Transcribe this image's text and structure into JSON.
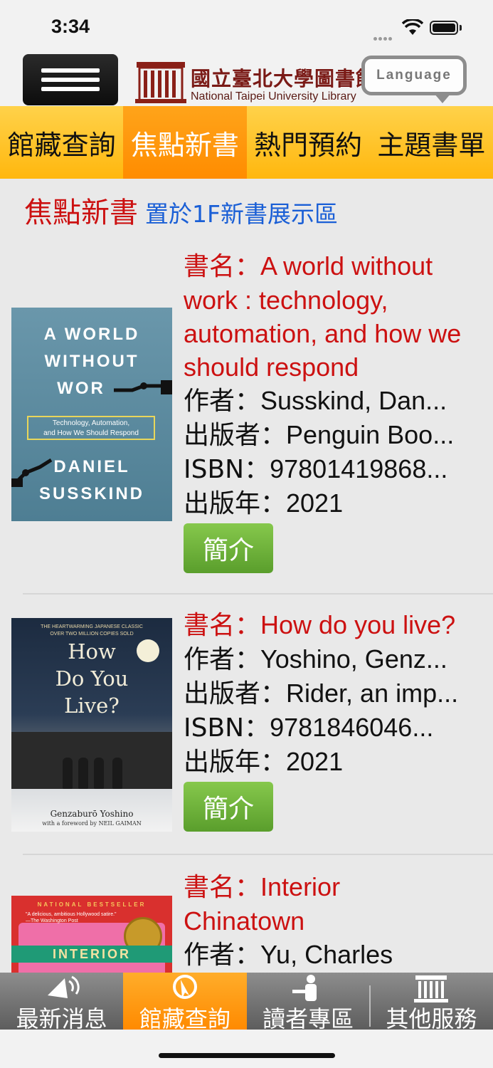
{
  "status_bar": {
    "time": "3:34"
  },
  "header": {
    "logo_title": "國立臺北大學圖書館",
    "logo_subtitle": "National Taipei University Library",
    "language_label": "Language"
  },
  "tabs": [
    {
      "label": "館藏查詢",
      "active": false
    },
    {
      "label": "焦點新書",
      "active": true
    },
    {
      "label": "熱門預約",
      "active": false
    },
    {
      "label": "主題書單",
      "active": false
    }
  ],
  "section": {
    "title": "焦點新書",
    "subtitle": "置於1F新書展示區"
  },
  "labels": {
    "title": "書名：",
    "author": "作者：",
    "publisher": "出版者：",
    "isbn": "ISBN：",
    "year": "出版年：",
    "intro_button": "簡介"
  },
  "books": [
    {
      "title": "A world without work : technology, automation, and how we should respond",
      "author": "Susskind, Dan...",
      "publisher": "Penguin Boo...",
      "isbn": "97801419868...",
      "year": "2021",
      "cover": {
        "line1": "A WORLD",
        "line2": "WITHOUT",
        "line3": "WOR",
        "box_line1": "Technology, Automation,",
        "box_line2": "and How We Should Respond",
        "author1": "DANIEL",
        "author2": "SUSSKIND",
        "color": "#5b8aa0"
      }
    },
    {
      "title": "How do you live?",
      "author": "Yoshino, Genz...",
      "publisher": "Rider, an imp...",
      "isbn": "9781846046...",
      "year": "2021",
      "cover": {
        "top_line1": "THE HEARTWARMING JAPANESE CLASSIC",
        "top_line2": "OVER TWO MILLION COPIES SOLD",
        "t1": "How",
        "t2": "Do You",
        "t3": "Live?",
        "author": "Genzaburō Yoshino",
        "foreword": "with a foreword by NEIL GAIMAN",
        "color": "#22344b"
      }
    },
    {
      "title": "Interior Chinatown",
      "author": "Yu, Charles",
      "cover": {
        "top": "NATIONAL BESTSELLER",
        "quote": "\"A delicious, ambitious Hollywood satire.\" —The Washington Post",
        "band": "INTERIOR",
        "color": "#d9302e"
      }
    }
  ],
  "bottom_tabs": [
    {
      "label": "最新消息",
      "icon": "megaphone-icon",
      "active": false
    },
    {
      "label": "館藏查詢",
      "icon": "search-cursor-icon",
      "active": true
    },
    {
      "label": "讀者專區",
      "icon": "reader-at-desk-icon",
      "active": false
    },
    {
      "label": "其他服務",
      "icon": "library-building-icon",
      "active": false
    }
  ],
  "colors": {
    "tab_bar": "#ffc526",
    "tab_active": "#ff9500",
    "title_red": "#cc1111",
    "subtitle_blue": "#1a5fd6",
    "intro_green": "#6fb03a"
  }
}
